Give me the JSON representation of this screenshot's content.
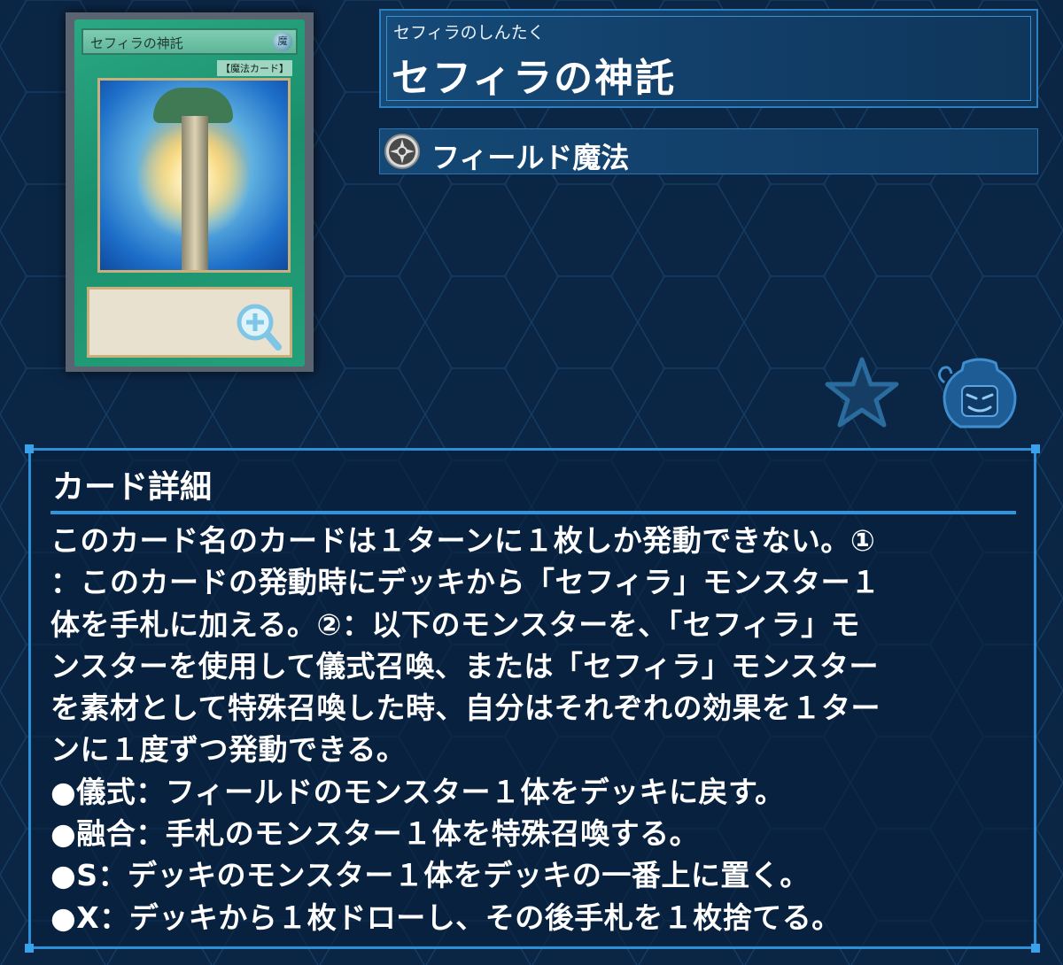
{
  "card": {
    "card_face_name": "セフィラの神託",
    "card_face_type": "【魔法カード】",
    "card_face_attribute": "魔"
  },
  "header": {
    "ruby": "セフィラのしんたく",
    "title": "セフィラの神託"
  },
  "type": {
    "label": "フィールド魔法",
    "icon": "field-spell-icon"
  },
  "actions": {
    "favorite_icon": "star-icon",
    "pot_icon": "pot-of-greed-icon"
  },
  "details": {
    "heading": "カード詳細",
    "lines": [
      "このカード名のカードは１ターンに１枚しか発動できない。①",
      "：このカードの発動時にデッキから「セフィラ」モンスター１",
      "体を手札に加える。②：以下のモンスターを、「セフィラ」モ",
      "ンスターを使用して儀式召喚、または「セフィラ」モンスター",
      "を素材として特殊召喚した時、自分はそれぞれの効果を１ター",
      "ンに１度ずつ発動できる。",
      "●儀式：フィールドのモンスター１体をデッキに戻す。",
      "●融合：手札のモンスター１体を特殊召喚する。",
      "●S：デッキのモンスター１体をデッキの一番上に置く。",
      "●X：デッキから１枚ドローし、その後手札を１枚捨てる。"
    ]
  },
  "colors": {
    "background": "#0b2645",
    "panel_border": "#2e8fd6",
    "card_green": "#1b8f6c"
  }
}
